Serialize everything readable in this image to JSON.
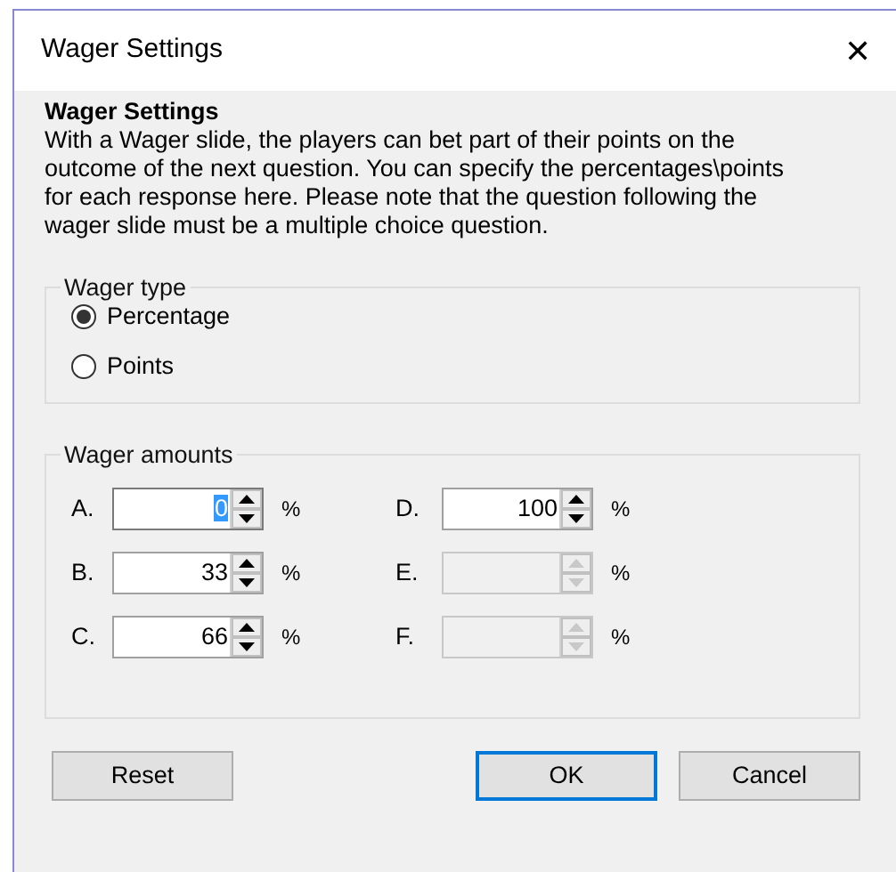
{
  "window": {
    "title": "Wager Settings",
    "close": "✕"
  },
  "heading": "Wager Settings",
  "description": "With a Wager slide, the players can bet part of their points on the outcome of the next question. You can specify the percentages\\points for each response here. Please note that the question following the wager slide must be a multiple choice question.",
  "wager_type": {
    "legend": "Wager type",
    "options": [
      {
        "label": "Percentage",
        "selected": true
      },
      {
        "label": "Points",
        "selected": false
      }
    ]
  },
  "wager_amounts": {
    "legend": "Wager amounts",
    "items": [
      {
        "label": "A.",
        "value": "0",
        "unit": "%",
        "disabled": false,
        "highlighted": true
      },
      {
        "label": "B.",
        "value": "33",
        "unit": "%",
        "disabled": false,
        "highlighted": false
      },
      {
        "label": "C.",
        "value": "66",
        "unit": "%",
        "disabled": false,
        "highlighted": false
      },
      {
        "label": "D.",
        "value": "100",
        "unit": "%",
        "disabled": false,
        "highlighted": false
      },
      {
        "label": "E.",
        "value": "",
        "unit": "%",
        "disabled": true,
        "highlighted": false
      },
      {
        "label": "F.",
        "value": "",
        "unit": "%",
        "disabled": true,
        "highlighted": false
      }
    ]
  },
  "buttons": [
    {
      "label": "Reset",
      "default": false
    },
    {
      "label": "OK",
      "default": true
    },
    {
      "label": "Cancel",
      "default": false
    }
  ]
}
